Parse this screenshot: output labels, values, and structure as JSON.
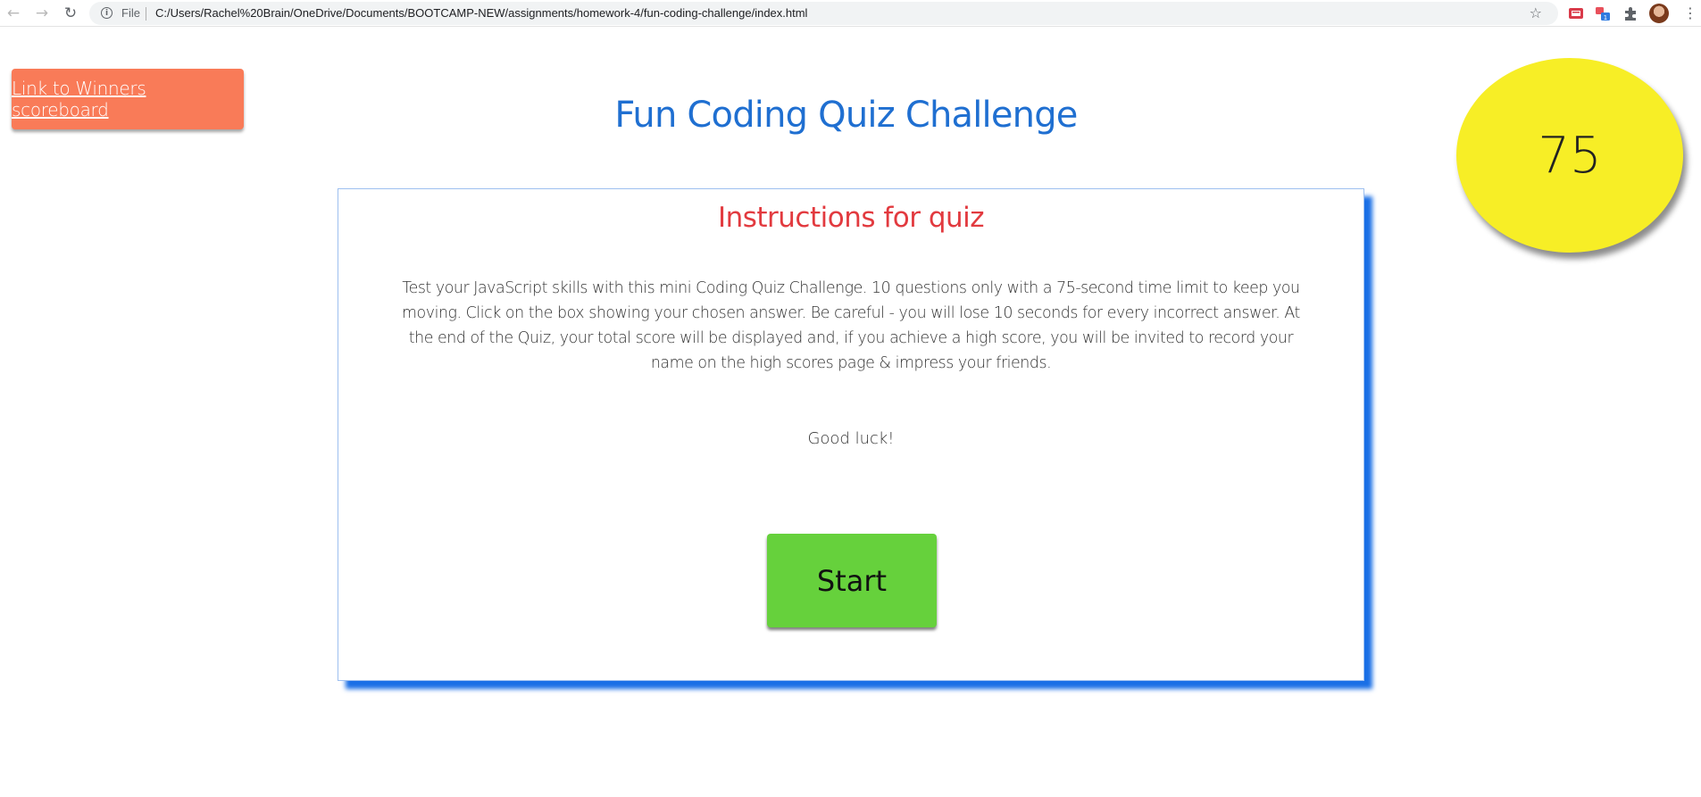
{
  "browser": {
    "scheme_label": "File",
    "url": "C:/Users/Rachel%20Brain/OneDrive/Documents/BOOTCAMP-NEW/assignments/homework-4/fun-coding-challenge/index.html",
    "icons": {
      "back": "arrow-left-icon",
      "forward": "arrow-right-icon",
      "reload": "reload-icon",
      "info": "info-icon",
      "bookmark": "star-icon",
      "menu": "kebab-menu-icon"
    },
    "extension_badge": "1"
  },
  "header": {
    "scoreboard_link_label": "Link to Winners scoreboard",
    "title": "Fun Coding Quiz Challenge",
    "timer_value": "75"
  },
  "instructions": {
    "title": "Instructions for quiz",
    "body": "Test your JavaScript skills with this mini Coding Quiz Challenge. 10 questions only with a 75-second time limit to keep you moving. Click on the box showing your chosen answer. Be careful - you will lose 10 seconds for every incorrect answer. At the end of the Quiz, your total score will be displayed and, if you achieve a high score, you will be invited to record your name on the high scores page & impress your friends.",
    "good_luck": "Good luck!",
    "start_label": "Start"
  },
  "colors": {
    "scoreboard_button": "#f97b58",
    "title": "#1f6fd1",
    "timer_circle": "#f7ee26",
    "card_shadow": "#1a6fe6",
    "instructions_title": "#e23a3f",
    "start_button": "#66d13c"
  }
}
